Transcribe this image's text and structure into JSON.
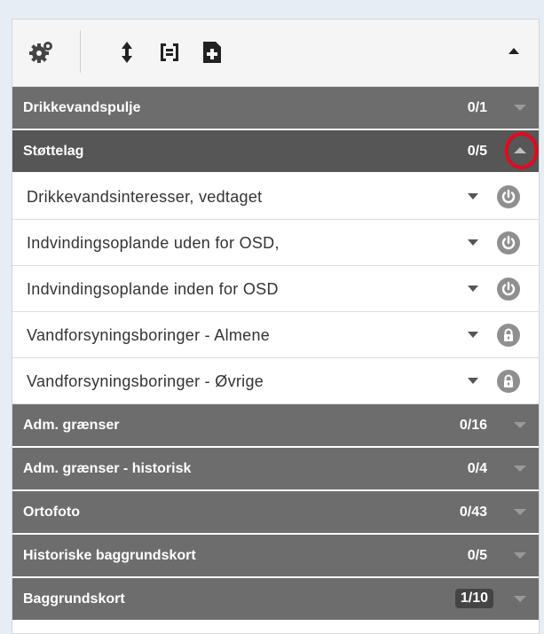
{
  "toolbar": {
    "icons": [
      "gear-icon",
      "expand-collapse-icon",
      "select-all-icon",
      "add-layer-icon"
    ],
    "collapse_icon": "chevron-up-icon"
  },
  "groups_top": [
    {
      "label": "Drikkevandspulje",
      "count": "0/1",
      "expanded": false
    },
    {
      "label": "Støttelag",
      "count": "0/5",
      "expanded": true
    }
  ],
  "layers": [
    {
      "label": "Drikkevandsinteresser, vedtaget",
      "state_icon": "power-icon"
    },
    {
      "label": "Indvindingsoplande uden for OSD,",
      "state_icon": "power-icon"
    },
    {
      "label": "Indvindingsoplande inden for OSD",
      "state_icon": "power-icon"
    },
    {
      "label": "Vandforsyningsboringer - Almene",
      "state_icon": "lock-icon"
    },
    {
      "label": "Vandforsyningsboringer - Øvrige",
      "state_icon": "lock-icon"
    }
  ],
  "groups_bottom": [
    {
      "label": "Adm. grænser",
      "count": "0/16"
    },
    {
      "label": "Adm. grænser - historisk",
      "count": "0/4"
    },
    {
      "label": "Ortofoto",
      "count": "0/43"
    },
    {
      "label": "Historiske baggrundskort",
      "count": "0/5"
    },
    {
      "label": "Baggrundskort",
      "count": "1/10"
    }
  ],
  "colors": {
    "group_bg": "#6d6d6d",
    "group_active_bg": "#565656",
    "highlight_ring": "#e3091f",
    "background": "#e6eef4"
  }
}
